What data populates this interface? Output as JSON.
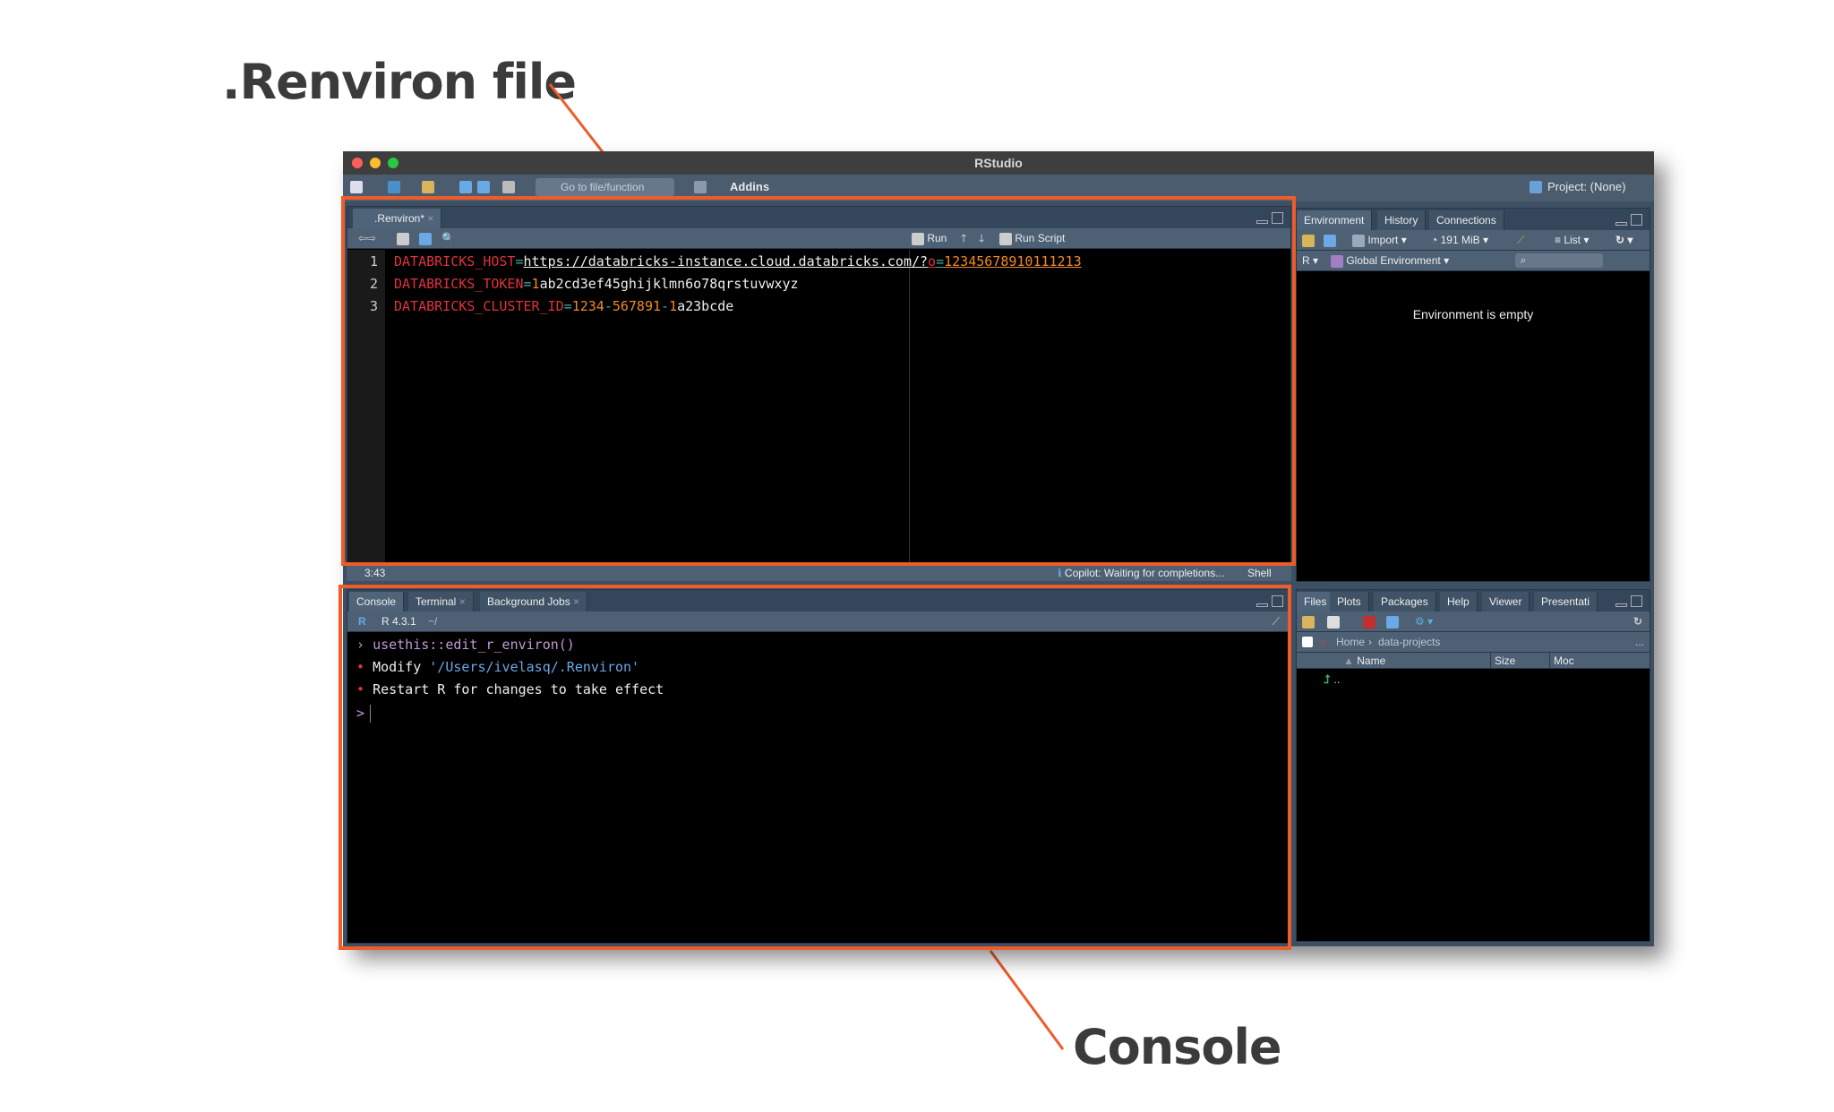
{
  "annotations": {
    "renviron_label": ".Renviron file",
    "console_label": "Console",
    "color": "#ee5c2a"
  },
  "window": {
    "title": "RStudio"
  },
  "toolbar": {
    "goto_placeholder": "Go to file/function",
    "addins": "Addins",
    "project": "Project: (None)"
  },
  "source": {
    "tab": ".Renviron*",
    "run": "Run",
    "run_script": "Run Script",
    "lines": [
      {
        "n": "1",
        "key": "DATABRICKS_HOST",
        "eq": "=",
        "value_a": "https://databricks-instance.cloud.databricks.com/?",
        "value_b": "o",
        "value_c": "=",
        "value_d": "12345678910111213"
      },
      {
        "n": "2",
        "key": "DATABRICKS_TOKEN",
        "eq": "=",
        "value_a": "1",
        "value_b": "ab2cd3ef45ghijklmn6o78qrstuvwxyz"
      },
      {
        "n": "3",
        "key": "DATABRICKS_CLUSTER_ID",
        "eq": "=",
        "value_a": "1234",
        "value_b": "-",
        "value_c": "567891",
        "value_d": "-",
        "value_e": "1",
        "value_f": "a23bcde"
      }
    ],
    "status": {
      "position": "3:43",
      "copilot": "Copilot: Waiting for completions...",
      "filetype": "Shell"
    }
  },
  "console": {
    "tabs": [
      "Console",
      "Terminal",
      "Background Jobs"
    ],
    "version": "R 4.3.1",
    "path": "~/",
    "lines": {
      "cmd": "usethis::edit_r_environ()",
      "modify": "Modify ",
      "modify_path": "'/Users/ivelasq/.Renviron'",
      "restart": "Restart R for changes to take effect"
    },
    "prompt": ">"
  },
  "environment": {
    "tabs": [
      "Environment",
      "History",
      "Connections"
    ],
    "import": "Import",
    "memory": "191 MiB",
    "list": "List",
    "lang": "R",
    "scope": "Global Environment",
    "empty": "Environment is empty"
  },
  "files": {
    "tabs": [
      "Files",
      "Plots",
      "Packages",
      "Help",
      "Viewer",
      "Presentati"
    ],
    "breadcrumb": [
      "Home",
      "data-projects"
    ],
    "more": "...",
    "columns": [
      "Name",
      "Size",
      "Moc"
    ],
    "rows": [
      ".."
    ]
  }
}
